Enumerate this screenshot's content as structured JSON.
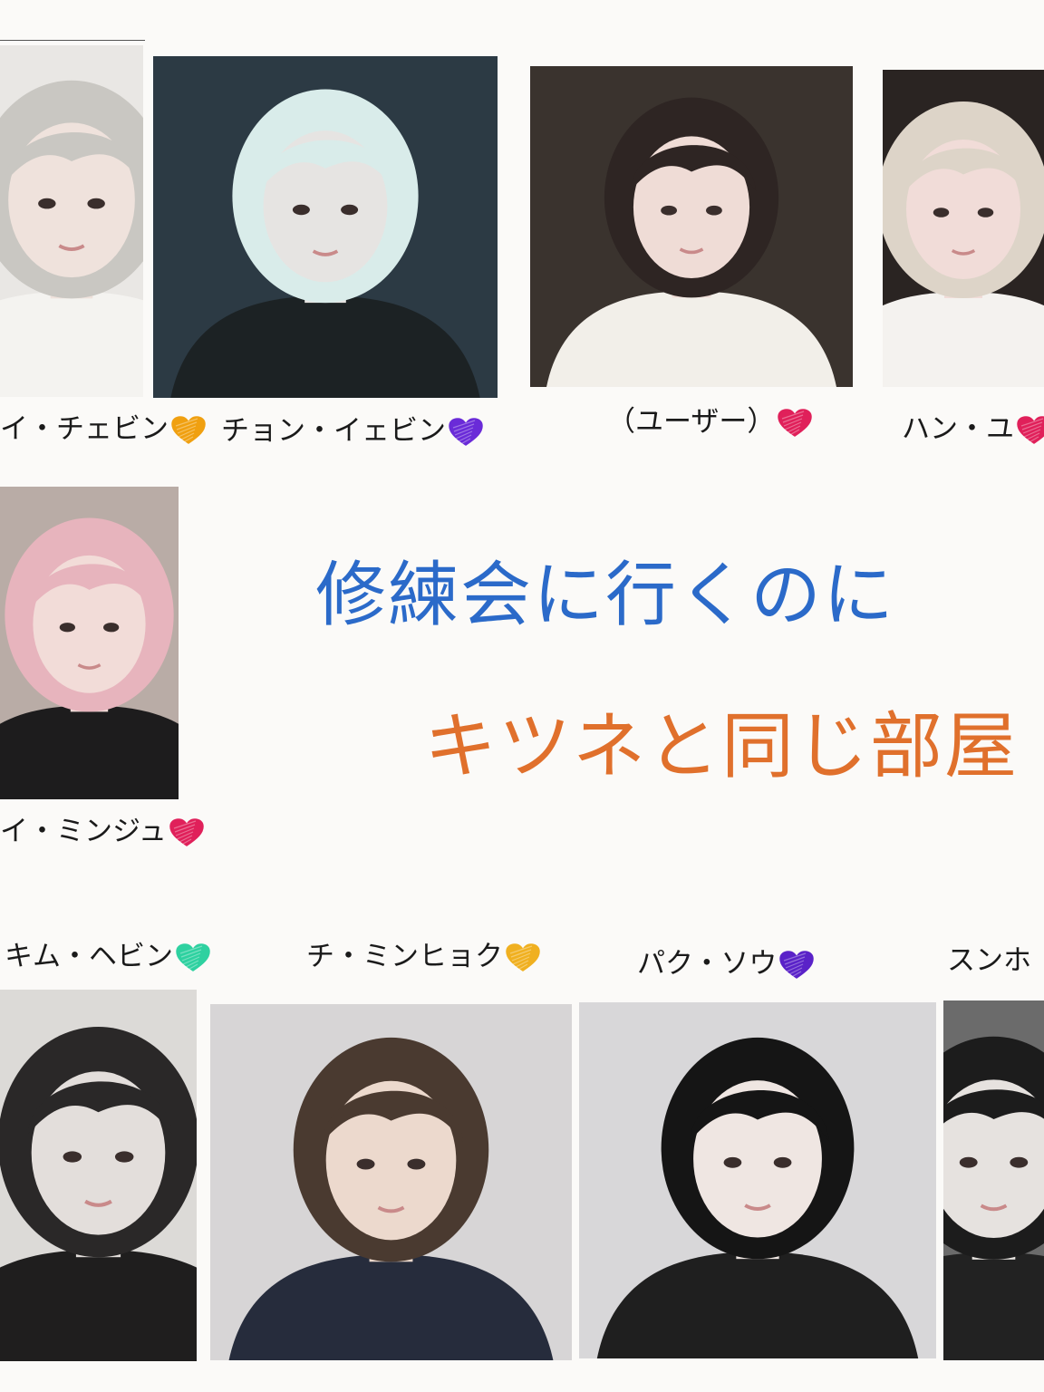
{
  "title": {
    "line1": "修練会に行くのに",
    "line2": "キツネと同じ部屋",
    "line1_color": "#2b6ac9",
    "line2_color": "#e0702c"
  },
  "characters": [
    {
      "id": "lee-chaebin",
      "name": "イ・チェビン",
      "heart_color": "#f0a010",
      "heart_icon": "heart-icon",
      "palette": {
        "bg": "#e9e7e4",
        "hair": "#c9c7c2",
        "skin": "#efe2dc",
        "cloth": "#f4f3f0"
      }
    },
    {
      "id": "jeon-ebin",
      "name": "チョン・イェビン",
      "heart_color": "#6a2bd8",
      "heart_icon": "heart-icon",
      "palette": {
        "bg": "#2c3a44",
        "hair": "#d9ecea",
        "skin": "#e6e4e2",
        "cloth": "#1c2224"
      }
    },
    {
      "id": "user",
      "name": "（ユーザー）",
      "heart_color": "#e0205a",
      "heart_icon": "heart-icon",
      "palette": {
        "bg": "#3a332e",
        "hair": "#2e2523",
        "skin": "#efdcd6",
        "cloth": "#f2efe9"
      }
    },
    {
      "id": "han-yu",
      "name": "ハン・ユ",
      "heart_color": "#e0205a",
      "heart_icon": "heart-icon",
      "palette": {
        "bg": "#2a2422",
        "hair": "#ddd4c8",
        "skin": "#f1dcd8",
        "cloth": "#f4f2ef"
      }
    },
    {
      "id": "lee-minju",
      "name": "イ・ミンジュ",
      "heart_color": "#e0205a",
      "heart_icon": "heart-icon",
      "palette": {
        "bg": "#b9aca6",
        "hair": "#e7b4bd",
        "skin": "#f2dcd8",
        "cloth": "#1d1c1d"
      }
    },
    {
      "id": "kim-haebin",
      "name": "キム・ヘビン",
      "heart_color": "#2ed1a0",
      "heart_icon": "heart-icon",
      "palette": {
        "bg": "#dcdad7",
        "hair": "#2a2828",
        "skin": "#e3dedb",
        "cloth": "#1f1e1e"
      }
    },
    {
      "id": "ji-minhyuk",
      "name": "チ・ミンヒョク",
      "heart_color": "#f0b020",
      "heart_icon": "heart-icon",
      "palette": {
        "bg": "#d7d5d6",
        "hair": "#4a3a30",
        "skin": "#ecd9cd",
        "cloth": "#262c3c"
      }
    },
    {
      "id": "park-sou",
      "name": "パク・ソウ",
      "heart_color": "#5a22c8",
      "heart_icon": "heart-icon",
      "palette": {
        "bg": "#d8d7d9",
        "hair": "#151515",
        "skin": "#efe6e2",
        "cloth": "#1f1f1f"
      }
    },
    {
      "id": "sunho",
      "name": "スンホ",
      "heart_color": "",
      "heart_icon": "",
      "palette": {
        "bg": "#6b6b6b",
        "hair": "#1c1c1c",
        "skin": "#e6e2df",
        "cloth": "#222222"
      }
    }
  ]
}
